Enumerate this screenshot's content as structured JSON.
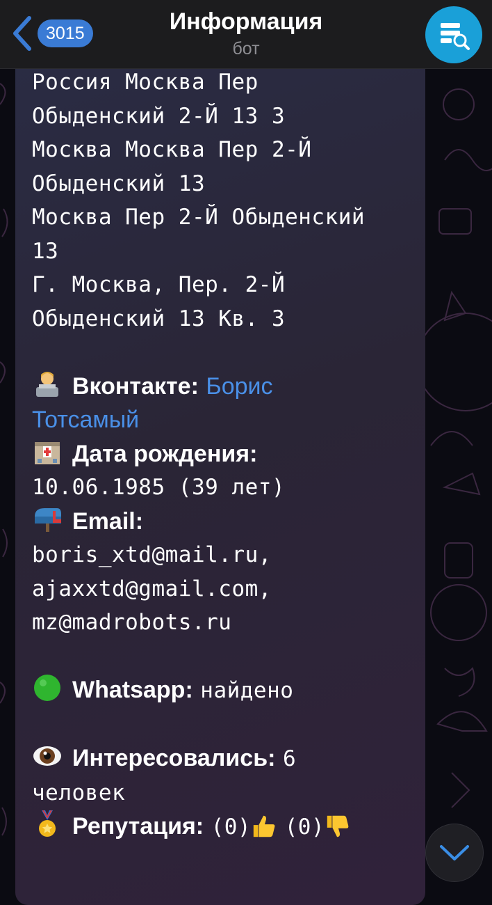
{
  "header": {
    "back_badge": "3015",
    "title": "Информация",
    "subtitle": "бот"
  },
  "message": {
    "addresses": [
      "Россия Москва Пер",
      "Обыденский 2-Й 13 3",
      "Москва Москва Пер 2-Й",
      "Обыденский 13",
      "Москва Пер 2-Й Обыденский",
      "13",
      "Г. Москва, Пер. 2-Й",
      "Обыденский 13 Кв. 3"
    ],
    "vk": {
      "label": "Вконтакте:",
      "value_1": "Борис",
      "value_2": "Тотсамый"
    },
    "birth": {
      "label": "Дата рождения:",
      "value": "10.06.1985 (39 лет)"
    },
    "email": {
      "label": "Email:",
      "values": [
        "boris_xtd@mail.ru,",
        "ajaxxtd@gmail.com,",
        "mz@madrobots.ru"
      ]
    },
    "whatsapp": {
      "label": "Whatsapp:",
      "value": "найдено"
    },
    "interest": {
      "label": "Интересовались:",
      "value_1": "6",
      "value_2": "человек"
    },
    "reputation": {
      "label": "Репутация:",
      "likes": "(0)",
      "dislikes": "(0)"
    }
  },
  "icons": {
    "back": "chevron-left-icon",
    "avatar": "server-search-icon",
    "scroll_down": "chevron-down-icon"
  },
  "colors": {
    "accent": "#3a7bd5",
    "link": "#4a90e8",
    "avatar": "#1aa0d8"
  }
}
